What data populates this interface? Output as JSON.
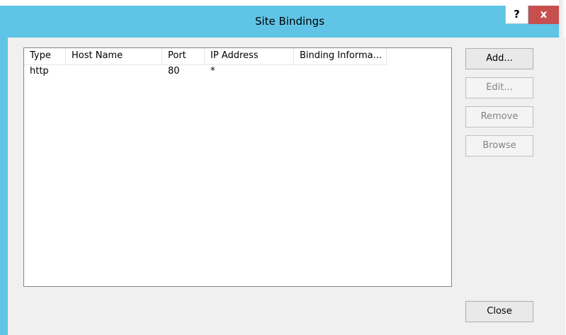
{
  "window": {
    "title": "Site Bindings",
    "help_label": "?",
    "close_label": "x"
  },
  "table": {
    "columns": [
      "Type",
      "Host Name",
      "Port",
      "IP Address",
      "Binding Informa..."
    ],
    "rows": [
      {
        "type": "http",
        "host_name": "",
        "port": "80",
        "ip_address": "*",
        "binding_info": ""
      }
    ]
  },
  "buttons": {
    "add": "Add...",
    "edit": "Edit...",
    "remove": "Remove",
    "browse": "Browse",
    "close": "Close"
  },
  "colors": {
    "title_bar": "#5fc4e6",
    "close_button": "#c7504f",
    "client_bg": "#f0f0f0"
  }
}
